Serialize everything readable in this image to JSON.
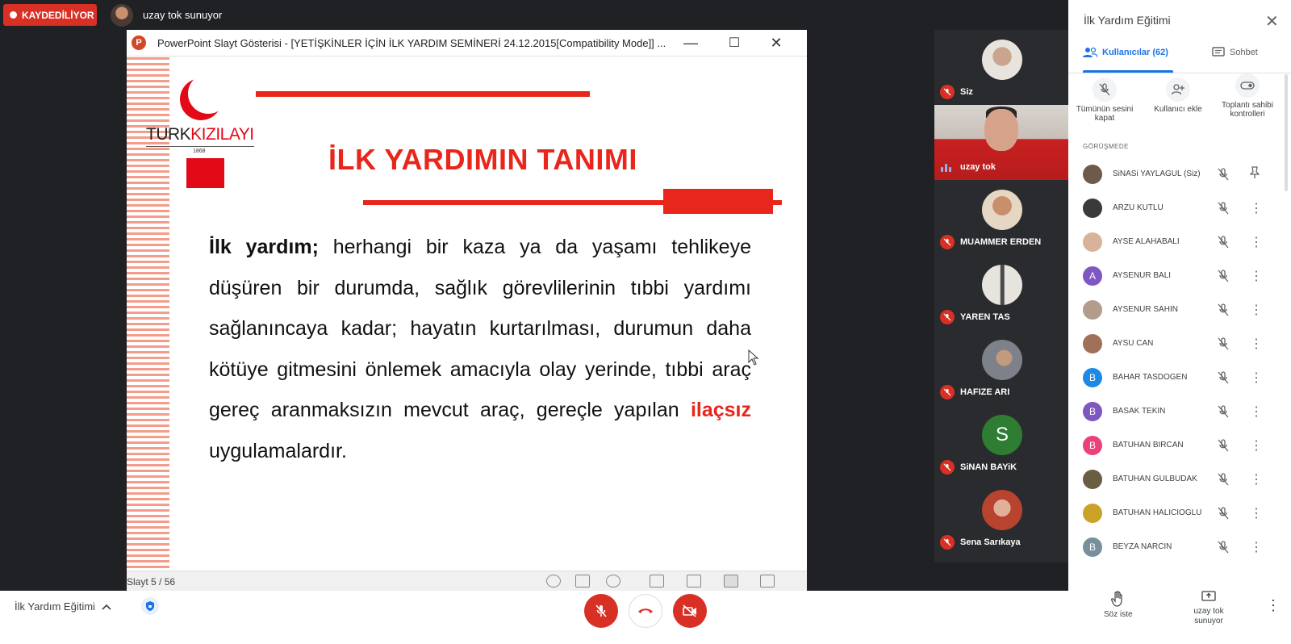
{
  "topbar": {
    "recording_label": "KAYDEDİLİYOR",
    "presenter_label": "uzay tok sunuyor"
  },
  "window": {
    "title": "PowerPoint Slayt Gösterisi - [YETİŞKİNLER İÇİN İLK YARDIM SEMİNERİ 24.12.2015[Compatibility Mode]] ...",
    "minimize": "—",
    "maximize": "☐",
    "close": "✕"
  },
  "slide": {
    "logo_turk": "TURK",
    "logo_kizilay": "KIZILAYI",
    "logo_year": "1868",
    "title": "İLK YARDIMIN TANIMI",
    "body_bold": "İlk yardım;",
    "body_part1": " herhangi bir kaza ya da yaşamı tehlikeye düşüren bir durumda, sağlık görevlilerinin tıbbi yardımı sağlanıncaya kadar; hayatın kurtarılması, durumun daha kötüye gitmesini önlemek amacıyla olay yerinde, tıbbi araç gereç aranmaksızın mevcut araç, gereçle yapılan ",
    "body_highlight": "ilaçsız",
    "body_part2": " uygulamalardır.",
    "counter": "Slayt 5 / 56"
  },
  "tiles": [
    {
      "name": "Siz",
      "avatar_color": "#cfc6bd"
    },
    {
      "name": "uzay tok",
      "video": true
    },
    {
      "name": "MUAMMER ERDEN",
      "avatar_color": "#d8b89c"
    },
    {
      "name": "YAREN TAS",
      "avatar_color": "#b8b2aa"
    },
    {
      "name": "HAFIZE ARI",
      "avatar_color": "#8c8f95"
    },
    {
      "name": "SiNAN BAYiK",
      "letter": "S",
      "avatar_color": "#2e7d32"
    },
    {
      "name": "Sena Sarıkaya",
      "avatar_color": "#c65d4a"
    }
  ],
  "panel": {
    "title": "İlk Yardım Eğitimi",
    "close": "✕",
    "tab_users": "Kullanıcılar (62)",
    "tab_chat": "Sohbet",
    "actions": [
      {
        "label": "Tümünün sesini kapat"
      },
      {
        "label": "Kullanıcı ekle"
      },
      {
        "label": "Toplantı sahibi kontrolleri"
      }
    ],
    "section_label": "GÖRÜŞMEDE",
    "people": [
      {
        "name": "SiNASi YAYLAGUL (Siz)",
        "color": "#6d5a4a",
        "letter": "",
        "pin": true
      },
      {
        "name": "ARZU KUTLU",
        "color": "#3a3a3a",
        "letter": ""
      },
      {
        "name": "AYSE ALAHABALI",
        "color": "#d8b39a",
        "letter": ""
      },
      {
        "name": "AYSENUR BALI",
        "color": "#7e57c2",
        "letter": "A"
      },
      {
        "name": "AYSENUR SAHIN",
        "color": "#b39c8c",
        "letter": ""
      },
      {
        "name": "AYSU CAN",
        "color": "#a0715a",
        "letter": ""
      },
      {
        "name": "BAHAR TASDOGEN",
        "color": "#1e88e5",
        "letter": "B"
      },
      {
        "name": "BASAK TEKIN",
        "color": "#7e57c2",
        "letter": "B"
      },
      {
        "name": "BATUHAN BIRCAN",
        "color": "#ec407a",
        "letter": "B"
      },
      {
        "name": "BATUHAN GULBUDAK",
        "color": "#6b5c44",
        "letter": ""
      },
      {
        "name": "BATUHAN HALICIOGLU",
        "color": "#c9a227",
        "letter": ""
      },
      {
        "name": "BEYZA NARCIN",
        "color": "#78909c",
        "letter": "B"
      }
    ]
  },
  "bottombar": {
    "meeting_name": "İlk Yardım Eğitimi",
    "raise_hand": "Söz iste",
    "present": "uzay tok sunuyor"
  },
  "colors": {
    "accent": "#1a73e8",
    "danger": "#d93025",
    "slide_red": "#e8261b"
  }
}
